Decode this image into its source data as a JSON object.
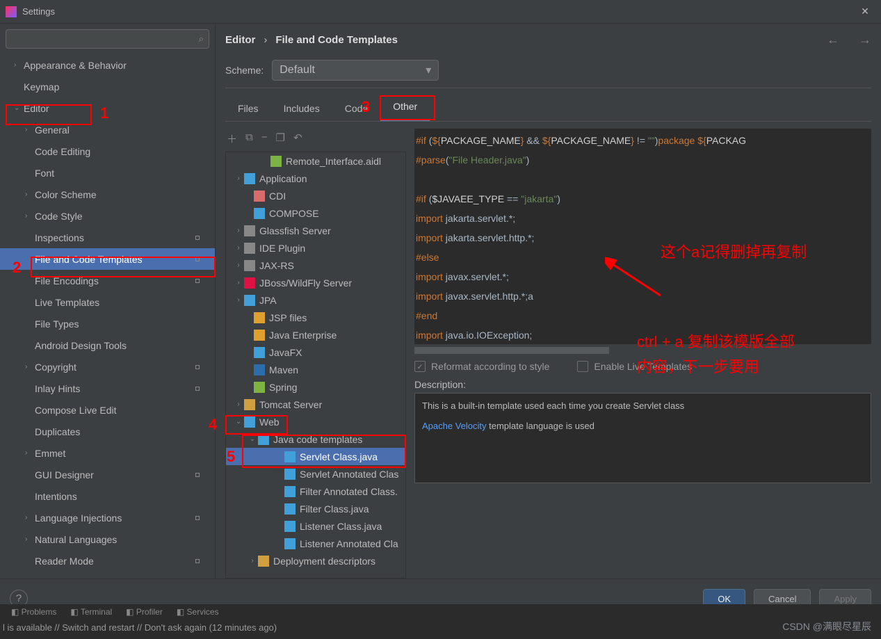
{
  "window": {
    "title": "Settings"
  },
  "sidebar": {
    "search_placeholder": "",
    "items": [
      {
        "label": "Appearance & Behavior",
        "chev": "›",
        "lvl": 0
      },
      {
        "label": "Keymap",
        "chev": "",
        "lvl": 0
      },
      {
        "label": "Editor",
        "chev": "⌄",
        "lvl": 0,
        "hl": 1
      },
      {
        "label": "General",
        "chev": "›",
        "lvl": 1
      },
      {
        "label": "Code Editing",
        "chev": "",
        "lvl": 1
      },
      {
        "label": "Font",
        "chev": "",
        "lvl": 1
      },
      {
        "label": "Color Scheme",
        "chev": "›",
        "lvl": 1
      },
      {
        "label": "Code Style",
        "chev": "›",
        "lvl": 1
      },
      {
        "label": "Inspections",
        "chev": "",
        "lvl": 1,
        "dot": 1
      },
      {
        "label": "File and Code Templates",
        "chev": "",
        "lvl": 1,
        "sel": 1,
        "dot": 1,
        "hl": 2
      },
      {
        "label": "File Encodings",
        "chev": "",
        "lvl": 1,
        "dot": 1
      },
      {
        "label": "Live Templates",
        "chev": "",
        "lvl": 1
      },
      {
        "label": "File Types",
        "chev": "",
        "lvl": 1
      },
      {
        "label": "Android Design Tools",
        "chev": "",
        "lvl": 1
      },
      {
        "label": "Copyright",
        "chev": "›",
        "lvl": 1,
        "dot": 1
      },
      {
        "label": "Inlay Hints",
        "chev": "",
        "lvl": 1,
        "dot": 1
      },
      {
        "label": "Compose Live Edit",
        "chev": "",
        "lvl": 1
      },
      {
        "label": "Duplicates",
        "chev": "",
        "lvl": 1
      },
      {
        "label": "Emmet",
        "chev": "›",
        "lvl": 1
      },
      {
        "label": "GUI Designer",
        "chev": "",
        "lvl": 1,
        "dot": 1
      },
      {
        "label": "Intentions",
        "chev": "",
        "lvl": 1
      },
      {
        "label": "Language Injections",
        "chev": "›",
        "lvl": 1,
        "dot": 1
      },
      {
        "label": "Natural Languages",
        "chev": "›",
        "lvl": 1
      },
      {
        "label": "Reader Mode",
        "chev": "",
        "lvl": 1,
        "dot": 1
      }
    ]
  },
  "breadcrumb": {
    "a": "Editor",
    "sep": "›",
    "b": "File and Code Templates"
  },
  "scheme": {
    "label": "Scheme:",
    "value": "Default"
  },
  "tabs": [
    "Files",
    "Includes",
    "Code",
    "Other"
  ],
  "tabActive": "Other",
  "tplTree": [
    {
      "pad": 48,
      "ic": "#7cb342",
      "label": "Remote_Interface.aidl"
    },
    {
      "pad": 10,
      "chev": "›",
      "ic": "#41a0d8",
      "label": "Application"
    },
    {
      "pad": 24,
      "ic": "#d86b6b",
      "label": "CDI"
    },
    {
      "pad": 24,
      "ic": "#41a0d8",
      "label": "COMPOSE"
    },
    {
      "pad": 10,
      "chev": "›",
      "ic": "#888",
      "label": "Glassfish Server"
    },
    {
      "pad": 10,
      "chev": "›",
      "ic": "#888",
      "label": "IDE Plugin"
    },
    {
      "pad": 10,
      "chev": "›",
      "ic": "#888",
      "label": "JAX-RS"
    },
    {
      "pad": 10,
      "chev": "›",
      "ic": "#d14",
      "label": "JBoss/WildFly Server"
    },
    {
      "pad": 10,
      "chev": "›",
      "ic": "#41a0d8",
      "label": "JPA"
    },
    {
      "pad": 24,
      "ic": "#e0a030",
      "label": "JSP files"
    },
    {
      "pad": 24,
      "ic": "#e0a030",
      "label": "Java Enterprise"
    },
    {
      "pad": 24,
      "ic": "#41a0d8",
      "label": "JavaFX"
    },
    {
      "pad": 24,
      "ic": "#2c6eab",
      "label": "Maven"
    },
    {
      "pad": 24,
      "ic": "#7cb342",
      "label": "Spring"
    },
    {
      "pad": 10,
      "chev": "›",
      "ic": "#d0a040",
      "label": "Tomcat Server"
    },
    {
      "pad": 10,
      "chev": "⌄",
      "ic": "#41a0d8",
      "label": "Web",
      "hl": 4
    },
    {
      "pad": 30,
      "chev": "⌄",
      "ic": "#41a0d8",
      "label": "Java code templates"
    },
    {
      "pad": 68,
      "ic": "#41a0d8",
      "label": "Servlet Class.java",
      "sel": 1,
      "hl": 5
    },
    {
      "pad": 68,
      "ic": "#41a0d8",
      "label": "Servlet Annotated Clas"
    },
    {
      "pad": 68,
      "ic": "#41a0d8",
      "label": "Filter Annotated Class."
    },
    {
      "pad": 68,
      "ic": "#41a0d8",
      "label": "Filter Class.java"
    },
    {
      "pad": 68,
      "ic": "#41a0d8",
      "label": "Listener Class.java"
    },
    {
      "pad": 68,
      "ic": "#41a0d8",
      "label": "Listener Annotated Cla"
    },
    {
      "pad": 30,
      "chev": "›",
      "ic": "#d0a040",
      "label": "Deployment descriptors"
    }
  ],
  "code": {
    "l1a": "#if ",
    "l1b": "(",
    "l1c": "${",
    "l1d": "PACKAGE_NAME",
    "l1e": "}",
    "l1f": " && ",
    "l1g": "${",
    "l1h": "PACKAGE_NAME",
    "l1i": "}",
    "l1j": " != ",
    "l1k": "\"\"",
    "l1l": ")",
    "l1m": "package ",
    "l1n": "${",
    "l1o": "PACKAG",
    "l2a": "#parse",
    "l2b": "(",
    "l2c": "\"File Header.java\"",
    "l2d": ")",
    "l3": "",
    "l4a": "#if ",
    "l4b": "(",
    "l4c": "$JAVAEE_TYPE",
    "l4d": " == ",
    "l4e": "\"jakarta\"",
    "l4f": ")",
    "l5a": "import ",
    "l5b": "jakarta.servlet.*",
    "l5c": ";",
    "l6a": "import ",
    "l6b": "jakarta.servlet.http.*",
    "l6c": ";",
    "l7": "#else",
    "l8a": "import ",
    "l8b": "javax.servlet.*",
    "l8c": ";",
    "l9a": "import ",
    "l9b": "javax.servlet.http.*",
    "l9c": ";",
    "l9d": "a",
    "l10": "#end",
    "l11a": "import ",
    "l11b": "java.io.IOException",
    "l11c": ";"
  },
  "checks": {
    "reformat": "Reformat according to style",
    "live": "Enable Live Templates"
  },
  "desc": {
    "label": "Description:",
    "text": "This is a built-in template used each time you create Servlet class",
    "link": "Apache Velocity",
    "tail": " template language is used"
  },
  "buttons": {
    "ok": "OK",
    "cancel": "Cancel",
    "apply": "Apply"
  },
  "annotations": {
    "a1": "1",
    "a2": "2",
    "a3": "3",
    "a4": "4",
    "a5": "5",
    "note1": "这个a记得删掉再复制",
    "note2a": "ctrl + a 复制该模版全部",
    "note2b": "内容，下一步要用"
  },
  "status": {
    "tools": [
      "Problems",
      "Terminal",
      "Profiler",
      "Services"
    ],
    "msg": "l is available // Switch and restart // Don't ask again (12 minutes ago)"
  },
  "watermark": "CSDN @满眼尽星辰"
}
